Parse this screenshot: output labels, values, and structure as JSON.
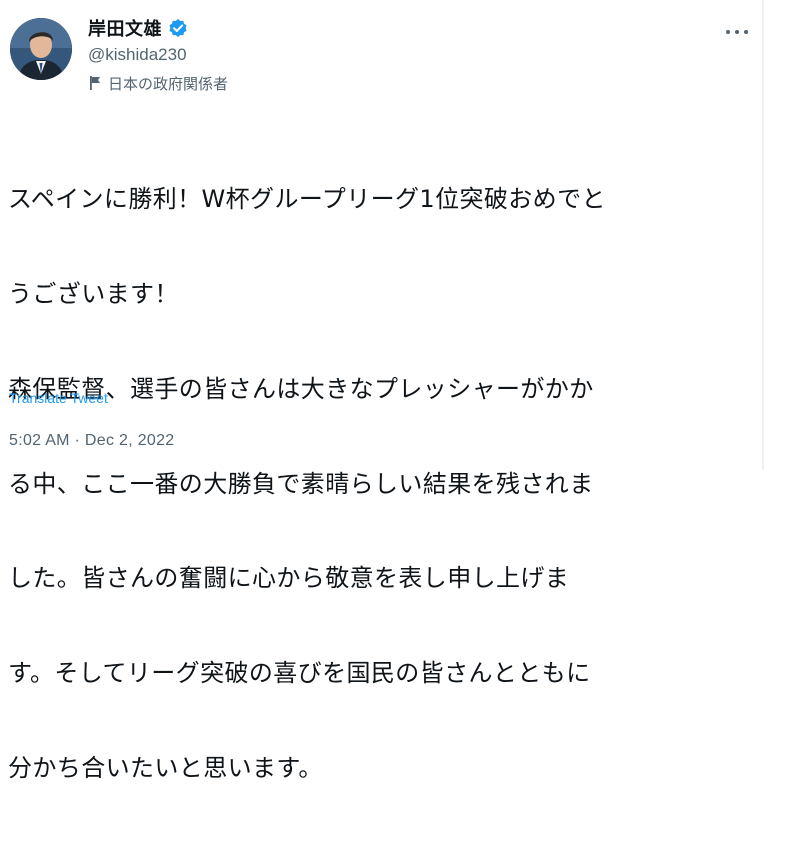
{
  "tweet": {
    "display_name": "岸田文雄",
    "handle": "@kishida230",
    "affiliation_label": "日本の政府関係者",
    "text_lines": [
      "スペインに勝利！W杯グループリーグ1位突破おめでと",
      "うございます！",
      "森保監督、選手の皆さんは大きなプレッシャーがかか",
      "る中、ここ一番の大勝負で素晴らしい結果を残されま",
      "した。皆さんの奮闘に心から敬意を表し申し上げま",
      "す。そしてリーグ突破の喜びを国民の皆さんとともに",
      "分かち合いたいと思います。"
    ],
    "translate_label": "Translate Tweet",
    "timestamp": "5:02 AM · Dec 2, 2022"
  },
  "icons": {
    "verified": "verified-badge-icon",
    "affiliation": "flag-icon",
    "more": "more-dots-icon"
  },
  "colors": {
    "verified_blue": "#1d9bf0",
    "link_blue": "#1d9bf0",
    "secondary_text": "#536471",
    "primary_text": "#0f1419"
  }
}
